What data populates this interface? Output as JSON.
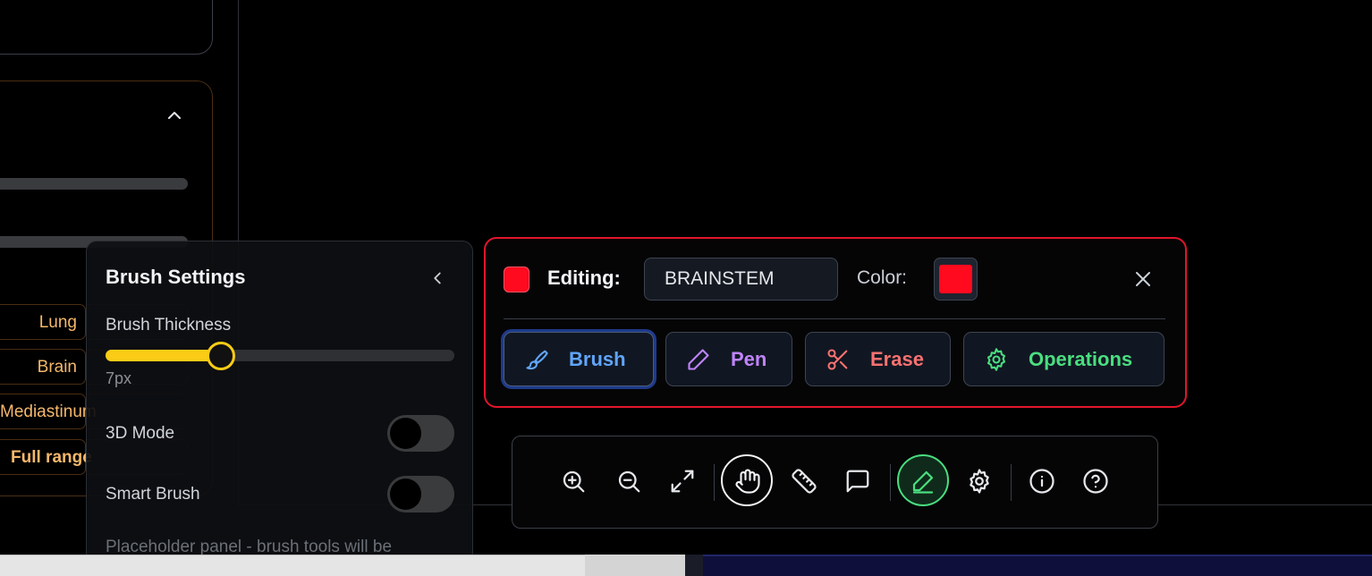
{
  "sidebar": {
    "presets": [
      "Lung",
      "Brain",
      "Mediastinum",
      "Full range"
    ]
  },
  "brush_settings": {
    "title": "Brush Settings",
    "thickness_label": "Brush Thickness",
    "thickness_value": "7px",
    "thickness_fraction": 0.33,
    "mode3d_label": "3D Mode",
    "mode3d_on": false,
    "smart_label": "Smart Brush",
    "smart_on": false,
    "note": "Placeholder panel - brush tools will be"
  },
  "editing": {
    "label": "Editing:",
    "segment_name": "BRAINSTEM",
    "color_label": "Color:",
    "color": "#ff0a1e",
    "tools": [
      {
        "label": "Brush",
        "color": "#60a5fa",
        "icon": "brush-icon",
        "active": true
      },
      {
        "label": "Pen",
        "color": "#c084fc",
        "icon": "pen-icon",
        "active": false
      },
      {
        "label": "Erase",
        "color": "#f87171",
        "icon": "scissors-icon",
        "active": false
      },
      {
        "label": "Operations",
        "color": "#4ade80",
        "icon": "gear-icon",
        "active": false
      }
    ]
  },
  "toolbar": {
    "items": [
      "zoom-in-icon",
      "zoom-out-icon",
      "fit-screen-icon",
      "pan-hand-icon",
      "ruler-icon",
      "comment-icon",
      "draw-pen-icon",
      "settings-icon",
      "info-icon",
      "help-icon"
    ],
    "active_pan": true,
    "active_draw": true
  }
}
